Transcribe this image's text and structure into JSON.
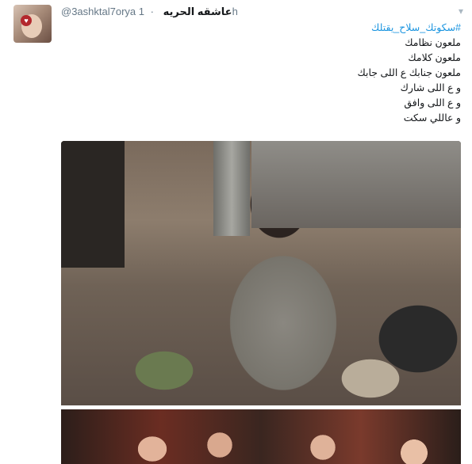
{
  "tweet": {
    "handle": "@3ashktal7orya",
    "display_name": "عاشقه الحريه",
    "separator": "·",
    "time": "1h",
    "caret_icon": "chevron-down-icon",
    "hashtag": "#سكوتك_سلاح_يقتلك",
    "lines": [
      "ملعون نظامك",
      "ملعون كلامك",
      "ملعون جنابك ع اللى جابك",
      "و ع اللى شارك",
      "و ع اللى وافق",
      "و عاللي سكت"
    ],
    "avatar_icon": "heart-icon"
  },
  "colors": {
    "link": "#1b95e0",
    "muted": "#657786",
    "text": "#14171a"
  }
}
